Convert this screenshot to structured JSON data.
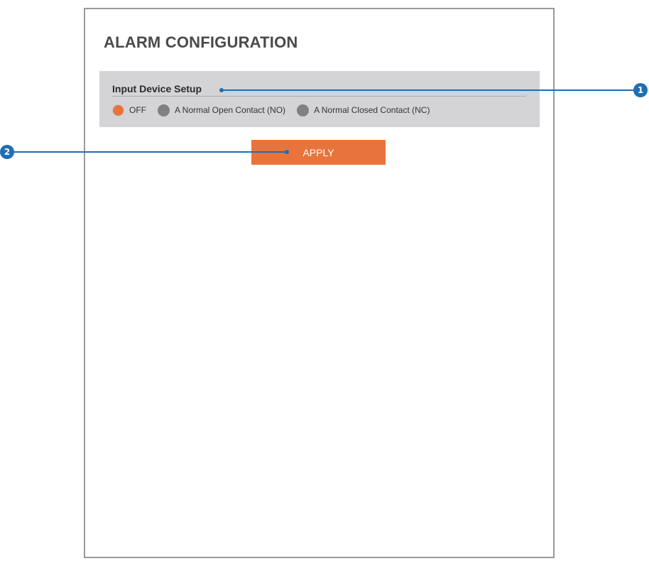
{
  "page": {
    "title": "ALARM CONFIGURATION"
  },
  "input_device_setup": {
    "title": "Input Device Setup",
    "options": [
      {
        "label": "OFF",
        "checked": true
      },
      {
        "label": "A Normal Open Contact (NO)",
        "checked": false
      },
      {
        "label": "A Normal Closed Contact (NC)",
        "checked": false
      }
    ]
  },
  "apply_button": {
    "label": "APPLY"
  },
  "callouts": {
    "one": "1",
    "two": "2"
  },
  "colors": {
    "accent": "#e8743b",
    "callout": "#1f6db3",
    "radio_unchecked": "#808080",
    "setup_bg": "#d4d4d6"
  }
}
